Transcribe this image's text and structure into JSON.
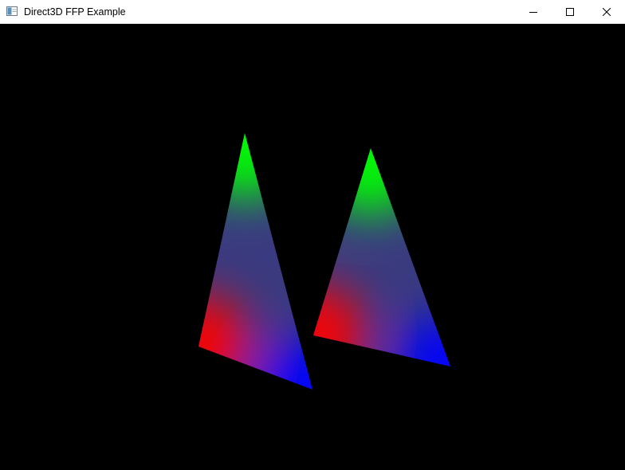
{
  "window": {
    "title": "Direct3D FFP Example",
    "icon": "app-window-icon",
    "controls": {
      "minimize_icon": "minimize-icon",
      "maximize_icon": "maximize-icon",
      "close_icon": "close-icon"
    }
  },
  "scene": {
    "background_color": "#000000",
    "vertex_colors": {
      "top": "#00ff00",
      "left": "#ff0000",
      "right": "#0000ff"
    },
    "triangles": [
      {
        "name": "triangle-left"
      },
      {
        "name": "triangle-right"
      }
    ]
  }
}
